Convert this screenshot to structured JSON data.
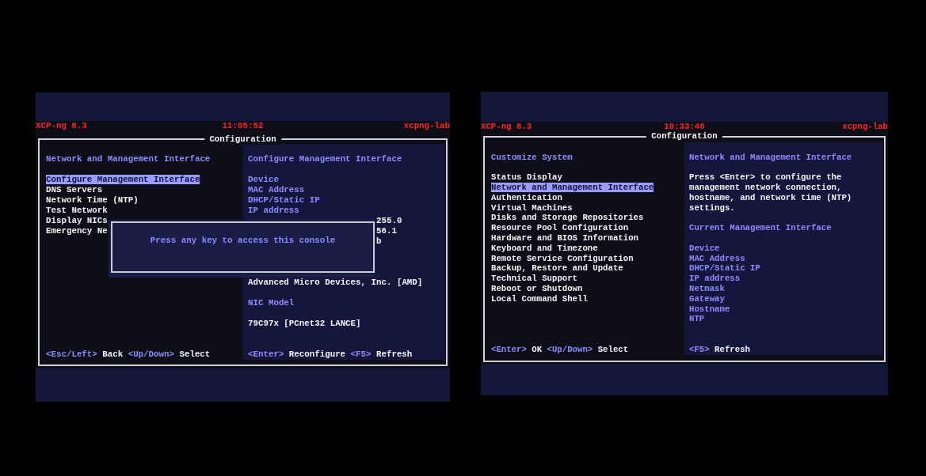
{
  "consoles": [
    {
      "status_bar": {
        "product": "XCP-ng 8.3",
        "clock": "11:05:52",
        "hostname": "xcpng-lab"
      },
      "window_title": "Configuration",
      "menu_pane": {
        "title": "Network and Management Interface",
        "items": [
          {
            "label": "Configure Management Interface",
            "selected": true
          },
          {
            "label": "DNS Servers",
            "selected": false
          },
          {
            "label": "Network Time (NTP)",
            "selected": false
          },
          {
            "label": "Test Network",
            "selected": false
          },
          {
            "label": "Display NICs",
            "selected": false
          },
          {
            "label": "Emergency Ne",
            "selected": false
          }
        ],
        "key_hints": [
          {
            "key": "<Esc/Left>",
            "action": "Back"
          },
          {
            "key": "<Up/Down>",
            "action": "Select"
          }
        ]
      },
      "detail_pane": {
        "sections": [
          {
            "kind": "heading",
            "text": "Configure Management Interface"
          },
          {
            "kind": "fields",
            "rows": [
              {
                "label": "Device"
              },
              {
                "label": "MAC Address"
              },
              {
                "label": "DHCP/Static IP"
              },
              {
                "label": "IP address"
              },
              {
                "value": "255.0"
              },
              {
                "value": "56.1"
              },
              {
                "value": "b"
              }
            ]
          },
          {
            "kind": "labelled_value",
            "value": "Advanced Micro Devices, Inc. [AMD]"
          },
          {
            "kind": "labelled_value",
            "label": "NIC Model",
            "value": "79C97x [PCnet32 LANCE]"
          }
        ],
        "key_hints": [
          {
            "key": "<Enter>",
            "action": "Reconfigure"
          },
          {
            "key": "<F5>",
            "action": "Refresh"
          }
        ]
      },
      "dialog": {
        "message": "Press any key to access this console"
      }
    },
    {
      "status_bar": {
        "product": "XCP-ng 8.3",
        "clock": "10:33:48",
        "hostname": "xcpng-lab"
      },
      "window_title": "Configuration",
      "menu_pane": {
        "title": "Customize System",
        "items": [
          {
            "label": "Status Display",
            "selected": false
          },
          {
            "label": "Network and Management Interface",
            "selected": true
          },
          {
            "label": "Authentication",
            "selected": false
          },
          {
            "label": "Virtual Machines",
            "selected": false
          },
          {
            "label": "Disks and Storage Repositories",
            "selected": false
          },
          {
            "label": "Resource Pool Configuration",
            "selected": false
          },
          {
            "label": "Hardware and BIOS Information",
            "selected": false
          },
          {
            "label": "Keyboard and Timezone",
            "selected": false
          },
          {
            "label": "Remote Service Configuration",
            "selected": false
          },
          {
            "label": "Backup, Restore and Update",
            "selected": false
          },
          {
            "label": "Technical Support",
            "selected": false
          },
          {
            "label": "Reboot or Shutdown",
            "selected": false
          },
          {
            "label": "Local Command Shell",
            "selected": false
          }
        ],
        "key_hints": [
          {
            "key": "<Enter>",
            "action": "OK"
          },
          {
            "key": "<Up/Down>",
            "action": "Select"
          }
        ]
      },
      "detail_pane": {
        "sections": [
          {
            "kind": "heading",
            "text": "Network and Management Interface"
          },
          {
            "kind": "paragraph",
            "text": "Press <Enter> to configure the management network connection, hostname, and network time (NTP) settings."
          },
          {
            "kind": "heading",
            "text": "Current Management Interface"
          },
          {
            "kind": "fields",
            "rows": [
              {
                "label": "Device"
              },
              {
                "label": "MAC Address"
              },
              {
                "label": "DHCP/Static IP"
              },
              {
                "label": "IP address"
              },
              {
                "label": "Netmask"
              },
              {
                "label": "Gateway"
              },
              {
                "label": "Hostname"
              },
              {
                "label": "NTP"
              }
            ]
          }
        ],
        "key_hints": [
          {
            "key": "<F5>",
            "action": "Refresh"
          }
        ]
      }
    }
  ]
}
